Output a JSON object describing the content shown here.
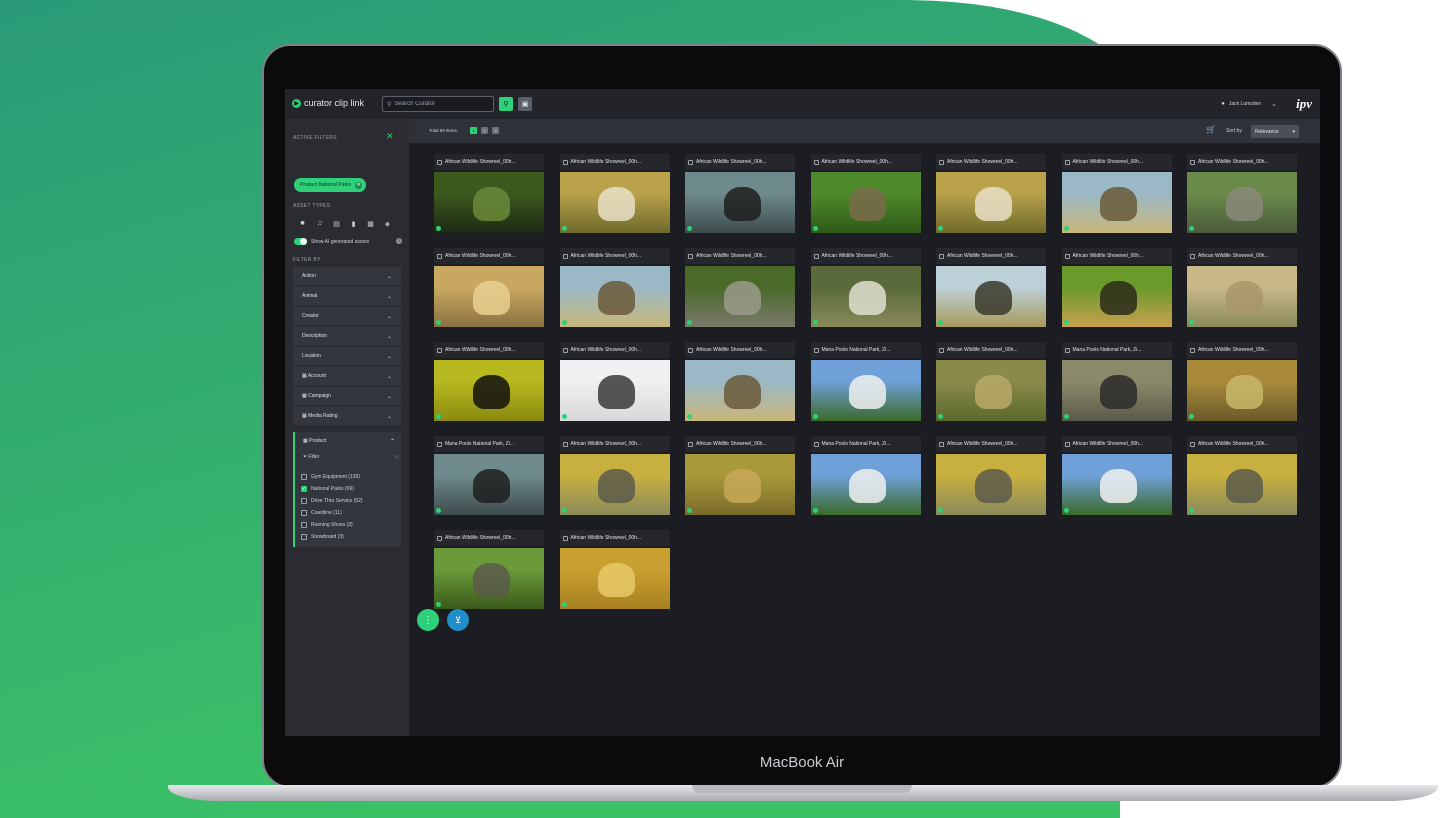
{
  "device": {
    "label": "MacBook Air"
  },
  "colors": {
    "accent": "#2fd07a",
    "basket": "#1f8ec9",
    "wave_top": "#2a9a78",
    "wave_bottom": "#3cc266"
  },
  "app": {
    "logo_text": "curator clip link",
    "brand": "ipv"
  },
  "search": {
    "placeholder": "Search Curator"
  },
  "header": {
    "user_name": "Jack Lumsden"
  },
  "sidebar": {
    "active_filters_label": "ACTIVE FILTERS",
    "active_chip": "Product National Parks",
    "asset_types_label": "ASSET TYPES",
    "asset_type_icons": [
      "video-icon",
      "audio-icon",
      "image-icon",
      "bookmark-icon",
      "film-icon",
      "collection-icon"
    ],
    "ai_toggle_label": "Show AI generated assets",
    "filter_by_label": "FILTER BY",
    "facets": [
      "Action",
      "Animal",
      "Creator",
      "Description",
      "Location",
      "Account",
      "Campaign",
      "Media Rating"
    ],
    "product": {
      "label": "Product",
      "filter_label": "Filter",
      "count_hint": "42",
      "options": [
        {
          "label": "Gym Equipment (130)",
          "checked": false
        },
        {
          "label": "National Parks (69)",
          "checked": true
        },
        {
          "label": "Drive Thru Service (52)",
          "checked": false
        },
        {
          "label": "Coastline (11)",
          "checked": false
        },
        {
          "label": "Running Shoes (3)",
          "checked": false
        },
        {
          "label": "Snowboard (3)",
          "checked": false
        }
      ]
    }
  },
  "toolbar": {
    "total": "Total 69 items.",
    "pages": [
      "1",
      "2",
      "3"
    ],
    "sort_label": "Sort by",
    "sort_value": "Relevance"
  },
  "assets": [
    {
      "title": "African Wildlife Showreel_00h...",
      "scene": "river"
    },
    {
      "title": "African Wildlife Showreel_00h...",
      "scene": "zebra"
    },
    {
      "title": "African Wildlife Showreel_00h...",
      "scene": "buffalo"
    },
    {
      "title": "African Wildlife Showreel_00h...",
      "scene": "grass-animal"
    },
    {
      "title": "African Wildlife Showreel_00h...",
      "scene": "zebra"
    },
    {
      "title": "African Wildlife Showreel_00h...",
      "scene": "vultures"
    },
    {
      "title": "African Wildlife Showreel_00h...",
      "scene": "elephants"
    },
    {
      "title": "African Wildlife Showreel_00h...",
      "scene": "lion"
    },
    {
      "title": "African Wildlife Showreel_00h...",
      "scene": "vultures"
    },
    {
      "title": "African Wildlife Showreel_00h...",
      "scene": "elephant-close"
    },
    {
      "title": "African Wildlife Showreel_00h...",
      "scene": "eagle-water"
    },
    {
      "title": "African Wildlife Showreel_00h...",
      "scene": "herd"
    },
    {
      "title": "African Wildlife Showreel_00h...",
      "scene": "cheetah"
    },
    {
      "title": "African Wildlife Showreel_00h...",
      "scene": "sand"
    },
    {
      "title": "African Wildlife Showreel_00h...",
      "scene": "kingfisher"
    },
    {
      "title": "African Wildlife Showreel_00h...",
      "scene": "bird-branch"
    },
    {
      "title": "African Wildlife Showreel_00h...",
      "scene": "vultures"
    },
    {
      "title": "Mana Pools National Park, Zi...",
      "scene": "eagle-tree"
    },
    {
      "title": "African Wildlife Showreel_00h...",
      "scene": "bush"
    },
    {
      "title": "Mana Pools National Park, Zi...",
      "scene": "dogs"
    },
    {
      "title": "African Wildlife Showreel_00h...",
      "scene": "flock"
    },
    {
      "title": "Mana Pools National Park, Zi...",
      "scene": "buffalo"
    },
    {
      "title": "African Wildlife Showreel_00h...",
      "scene": "elephant"
    },
    {
      "title": "African Wildlife Showreel_00h...",
      "scene": "cheetah-sit"
    },
    {
      "title": "Mana Pools National Park, Zi...",
      "scene": "eagle-tree"
    },
    {
      "title": "African Wildlife Showreel_00h...",
      "scene": "elephant"
    },
    {
      "title": "African Wildlife Showreel_00h...",
      "scene": "eagle-tree"
    },
    {
      "title": "African Wildlife Showreel_00h...",
      "scene": "elephant"
    },
    {
      "title": "African Wildlife Showreel_00h...",
      "scene": "monitor"
    },
    {
      "title": "African Wildlife Showreel_00h...",
      "scene": "lion-close"
    }
  ]
}
